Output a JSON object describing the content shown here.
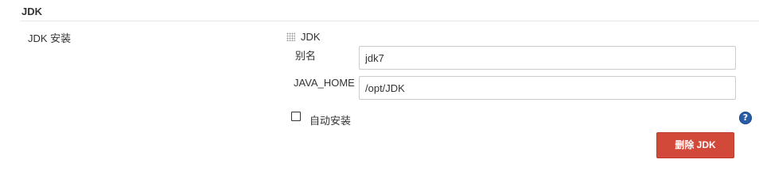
{
  "section": {
    "title": "JDK"
  },
  "field": {
    "label": "JDK 安装"
  },
  "jdk_block": {
    "title": "JDK",
    "handle_icon": "drag-handle-icon",
    "alias": {
      "label": "别名",
      "value": "jdk7"
    },
    "java_home": {
      "label": "JAVA_HOME",
      "value": "/opt/JDK"
    },
    "auto_install": {
      "label": "自动安装",
      "checked": false
    },
    "help_icon": "question-mark-icon",
    "help_glyph": "?",
    "delete_label": "删除 JDK"
  },
  "colors": {
    "delete_button": "#d24939",
    "help_icon": "#2a5da8"
  }
}
